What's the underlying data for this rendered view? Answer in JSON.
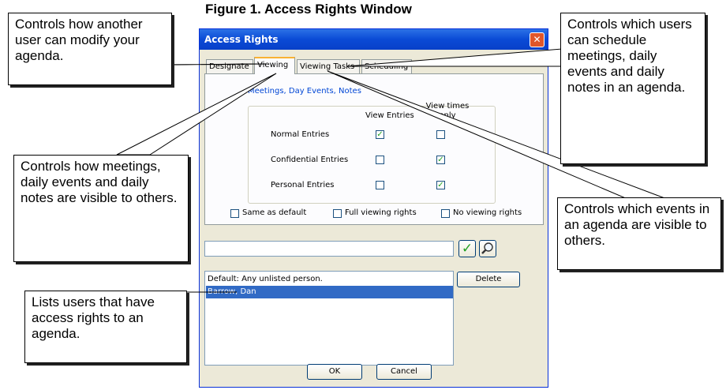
{
  "figure_caption": "Figure 1. Access Rights Window",
  "callouts": {
    "modify": "Controls how another user can modify your agenda.",
    "schedule": "Controls which users can schedule meetings, daily events and daily notes in an agenda.",
    "visible": "Controls how meetings, daily events and daily notes are visible to others.",
    "events": "Controls which events in an agenda are visible to others.",
    "lists": "Lists users that have access rights to an agenda."
  },
  "dialog": {
    "title": "Access Rights",
    "close_glyph": "✕",
    "tabs": [
      "Designate",
      "Viewing",
      "Viewing Tasks",
      "Scheduling"
    ],
    "active_tab": "Viewing",
    "group_label": "Meetings, Day Events, Notes",
    "col_view_entries": "View Entries",
    "col_view_times": "View times only",
    "rows": [
      {
        "label": "Normal Entries",
        "view_entries": true,
        "view_times": false
      },
      {
        "label": "Confidential Entries",
        "view_entries": false,
        "view_times": true
      },
      {
        "label": "Personal Entries",
        "view_entries": false,
        "view_times": true
      }
    ],
    "options": [
      "Same as default",
      "Full viewing rights",
      "No viewing rights"
    ],
    "check_glyph": "✓",
    "search_value": "",
    "confirm_glyph": "✓",
    "list": {
      "items": [
        "Default: Any unlisted person.",
        "Barrow, Dan"
      ],
      "selected": "Barrow, Dan"
    },
    "delete_label": "Delete",
    "ok_label": "OK",
    "cancel_label": "Cancel"
  },
  "colors": {
    "title_bar": "#0a4ad6",
    "selection": "#316ac5",
    "group_label": "#0046d5",
    "check": "#21a121"
  }
}
